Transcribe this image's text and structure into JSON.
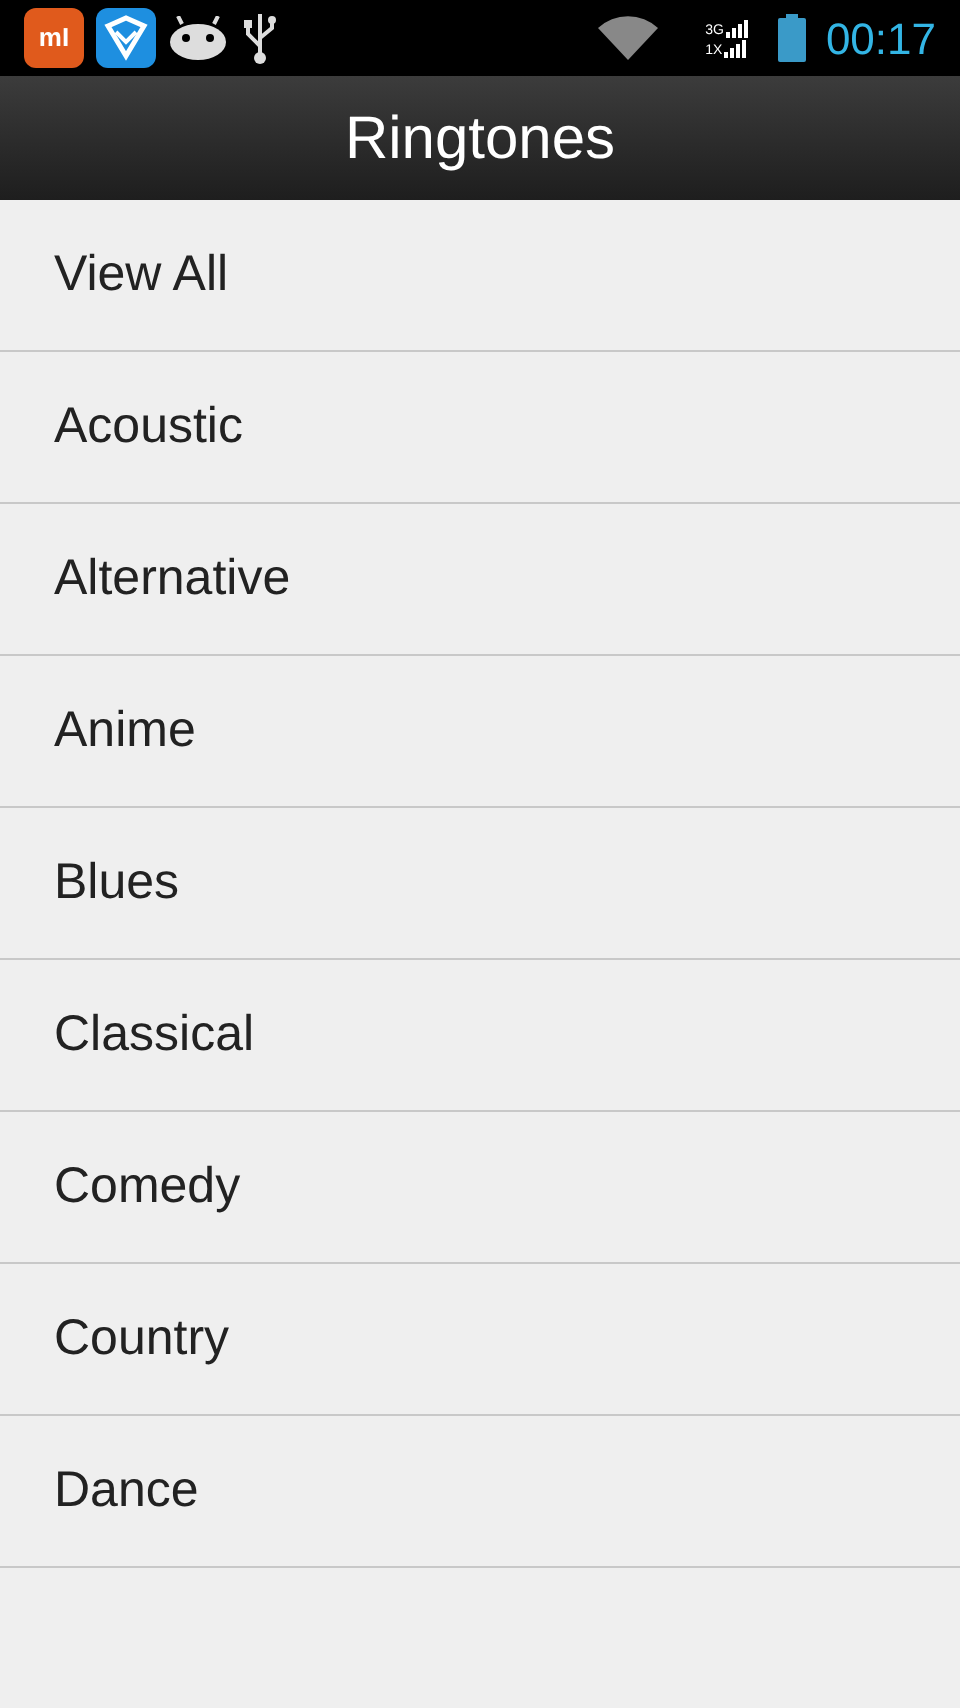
{
  "status_bar": {
    "app_badge": "mI",
    "signal_labels": [
      "3G",
      "1X"
    ],
    "time": "00:17"
  },
  "title": "Ringtones",
  "items": [
    {
      "label": "View All"
    },
    {
      "label": "Acoustic"
    },
    {
      "label": "Alternative"
    },
    {
      "label": "Anime"
    },
    {
      "label": "Blues"
    },
    {
      "label": "Classical"
    },
    {
      "label": "Comedy"
    },
    {
      "label": "Country"
    },
    {
      "label": "Dance"
    }
  ]
}
